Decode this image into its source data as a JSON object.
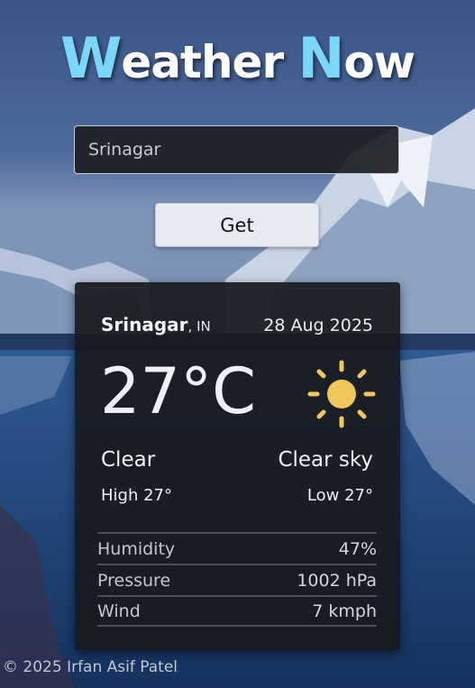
{
  "header": {
    "title_first_big": "W",
    "title_first_rest": "eather ",
    "title_second_big": "N",
    "title_second_rest": "ow"
  },
  "search": {
    "value": "Srinagar",
    "button_label": "Get"
  },
  "weather": {
    "city": "Srinagar",
    "country": ", IN",
    "date": "28 Aug 2025",
    "temperature": "27°C",
    "icon": "sun-icon",
    "condition": "Clear",
    "description": "Clear sky",
    "high": "High 27°",
    "low": "Low 27°",
    "stats": [
      {
        "label": "Humidity",
        "value": "47%"
      },
      {
        "label": "Pressure",
        "value": "1002 hPa"
      },
      {
        "label": "Wind",
        "value": "7 kmph"
      }
    ]
  },
  "footer": {
    "text": "© 2025 Irfan Asif Patel"
  },
  "colors": {
    "accent": "#7ad7f7",
    "sun": "#f2c75a",
    "card": "#181a1f"
  }
}
